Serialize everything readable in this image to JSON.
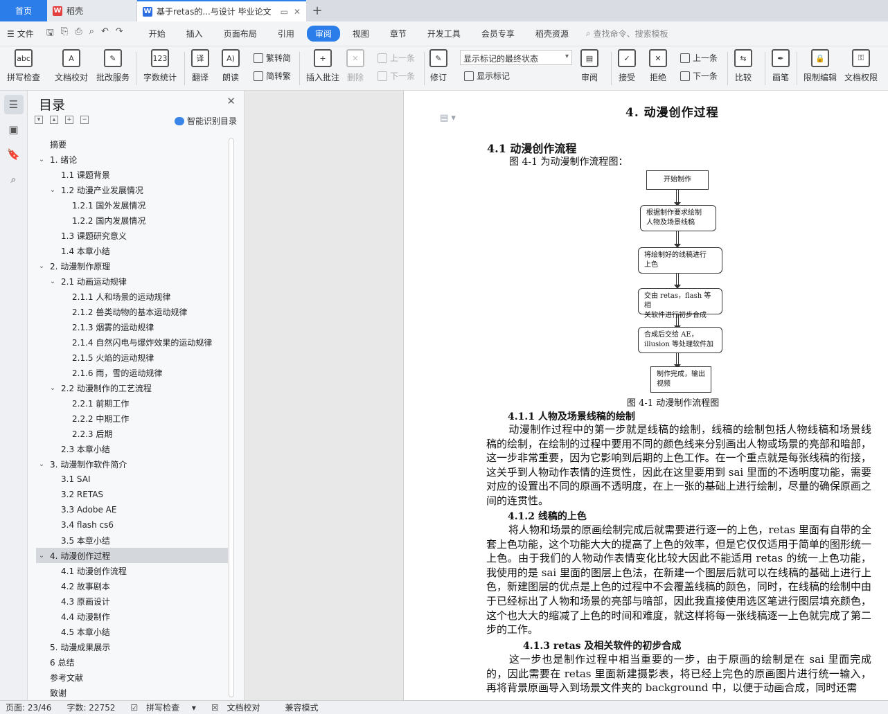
{
  "tabs": {
    "home": "首页",
    "daoke": "稻壳",
    "doc": "基于retas的...与设计 毕业论文"
  },
  "menu": {
    "file": "文件",
    "items": [
      "开始",
      "插入",
      "页面布局",
      "引用",
      "审阅",
      "视图",
      "章节",
      "开发工具",
      "会员专享",
      "稻壳资源"
    ],
    "active": "审阅",
    "search": "查找命令、搜索模板"
  },
  "ribbon": {
    "spell": "拼写检查",
    "proof": "文档校对",
    "annot_service": "批改服务",
    "word_count": "字数统计",
    "translate": "翻译",
    "read": "朗读",
    "to_trad": "繁转简",
    "to_simp": "简转繁",
    "insert_comment": "插入批注",
    "delete": "删除",
    "prev": "上一条",
    "next": "下一条",
    "revise": "修订",
    "display_state": "显示标记的最终状态",
    "show_marks": "显示标记",
    "review": "审阅",
    "accept": "接受",
    "reject": "拒绝",
    "prev2": "上一条",
    "next2": "下一条",
    "compare": "比较",
    "pen": "画笔",
    "restrict": "限制编辑",
    "doc_rights": "文档权限"
  },
  "toc": {
    "title": "目录",
    "smart": "智能识别目录",
    "items": [
      {
        "text": "摘要",
        "level": 0,
        "arrow": ""
      },
      {
        "text": "1.   绪论",
        "level": 0,
        "arrow": "v"
      },
      {
        "text": "1.1  课题背景",
        "level": 1,
        "arrow": ""
      },
      {
        "text": "1.2  动漫产业发展情况",
        "level": 1,
        "arrow": "v"
      },
      {
        "text": "1.2.1  国外发展情况",
        "level": 2,
        "arrow": ""
      },
      {
        "text": "1.2.2  国内发展情况",
        "level": 2,
        "arrow": ""
      },
      {
        "text": "1.3  课题研究意义",
        "level": 1,
        "arrow": ""
      },
      {
        "text": "1.4  本章小结",
        "level": 1,
        "arrow": ""
      },
      {
        "text": "2.   动漫制作原理",
        "level": 0,
        "arrow": "v"
      },
      {
        "text": "2.1 动画运动规律",
        "level": 1,
        "arrow": "v"
      },
      {
        "text": "2.1.1 人和场景的运动规律",
        "level": 2,
        "arrow": ""
      },
      {
        "text": "2.1.2 兽类动物的基本运动规律",
        "level": 2,
        "arrow": ""
      },
      {
        "text": "2.1.3 烟雾的运动规律",
        "level": 2,
        "arrow": ""
      },
      {
        "text": "2.1.4 自然闪电与爆炸效果的运动规律",
        "level": 2,
        "arrow": ""
      },
      {
        "text": "2.1.5 火焰的运动规律",
        "level": 2,
        "arrow": ""
      },
      {
        "text": "2.1.6  雨，雪的运动规律",
        "level": 2,
        "arrow": ""
      },
      {
        "text": "2.2 动漫制作的工艺流程",
        "level": 1,
        "arrow": "v"
      },
      {
        "text": "2.2.1  前期工作",
        "level": 2,
        "arrow": ""
      },
      {
        "text": "2.2.2  中期工作",
        "level": 2,
        "arrow": ""
      },
      {
        "text": "2.2.3  后期",
        "level": 2,
        "arrow": ""
      },
      {
        "text": "2.3  本章小结",
        "level": 1,
        "arrow": ""
      },
      {
        "text": "3.   动漫制作软件简介",
        "level": 0,
        "arrow": "v"
      },
      {
        "text": "3.1 SAI",
        "level": 1,
        "arrow": ""
      },
      {
        "text": "3.2 RETAS",
        "level": 1,
        "arrow": ""
      },
      {
        "text": "3.3 Adobe AE",
        "level": 1,
        "arrow": ""
      },
      {
        "text": "3.4 flash cs6",
        "level": 1,
        "arrow": ""
      },
      {
        "text": "3.5  本章小结",
        "level": 1,
        "arrow": ""
      },
      {
        "text": "4.   动漫创作过程",
        "level": 0,
        "arrow": "v",
        "selected": true
      },
      {
        "text": "4.1  动漫创作流程",
        "level": 1,
        "arrow": ""
      },
      {
        "text": "4.2  故事剧本",
        "level": 1,
        "arrow": ""
      },
      {
        "text": "4.3  原画设计",
        "level": 1,
        "arrow": ""
      },
      {
        "text": "4.4  动漫制作",
        "level": 1,
        "arrow": ""
      },
      {
        "text": "4.5  本章小结",
        "level": 1,
        "arrow": ""
      },
      {
        "text": "5.   动漫成果展示",
        "level": 0,
        "arrow": ""
      },
      {
        "text": "6    总结",
        "level": 0,
        "arrow": ""
      },
      {
        "text": "参考文献",
        "level": 0,
        "arrow": ""
      },
      {
        "text": "致谢",
        "level": 0,
        "arrow": ""
      }
    ]
  },
  "doc": {
    "h1": "4.   动漫创作过程",
    "h2": "4.1  动漫创作流程",
    "intro": "图 4-1 为动漫制作流程图：",
    "flow": [
      "开始制作",
      "根据制作要求绘制\n人物及场景线稿",
      "将绘制好的线稿进行\n上色",
      "交由 retas，flash 等相\n关软件进行初步合成",
      "合成后交给  AE，\nillusion 等处理软件加",
      "制作完成，输出\n视频"
    ],
    "fig_caption": "图 4-1   动漫制作流程图",
    "s411": "4.1.1 人物及场景线稿的绘制",
    "p1": "动漫制作过程中的第一步就是线稿的绘制，线稿的绘制包括人物线稿和场景线稿的绘制，在绘制的过程中要用不同的颜色线来分别画出人物或场景的亮部和暗部，这一步非常重要，因为它影响到后期的上色工作。在一个重点就是每张线稿的衔接，这关乎到人物动作表情的连贯性，因此在这里要用到 sai 里面的不透明度功能，需要对应的设置出不同的原画不透明度，在上一张的基础上进行绘制，尽量的确保原画之间的连贯性。",
    "s412": "4.1.2  线稿的上色",
    "p2": "将人物和场景的原画绘制完成后就需要进行逐一的上色，retas 里面有自带的全套上色功能，这个功能大大的提高了上色的效率，但是它仅仅适用于简单的图形统一上色。由于我们的人物动作表情变化比较大因此不能适用 retas 的统一上色功能，我使用的是 sai 里面的图层上色法，在新建一个图层后就可以在线稿的基础上进行上色，新建图层的优点是上色的过程中不会覆盖线稿的颜色，同时，在线稿的绘制中由于已经标出了人物和场景的亮部与暗部，因此我直接使用选区笔进行图层填充颜色，这个也大大的缩减了上色的时间和难度，就这样将每一张线稿逐一上色就完成了第二步的工作。",
    "s413": "4.1.3 retas 及相关软件的初步合成",
    "p3": "这一步也是制作过程中相当重要的一步，由于原画的绘制是在 sai 里面完成的，因此需要在 retas 里面新建摄影表，将已经上完色的原画图片进行统一输入，再将背景原画导入到场景文件夹的 background 中，以便于动画合成，同时还需"
  },
  "status": {
    "page": "页面: 23/46",
    "words": "字数: 22752",
    "spell": "拼写检查",
    "proof": "文档校对",
    "compat": "兼容模式"
  }
}
